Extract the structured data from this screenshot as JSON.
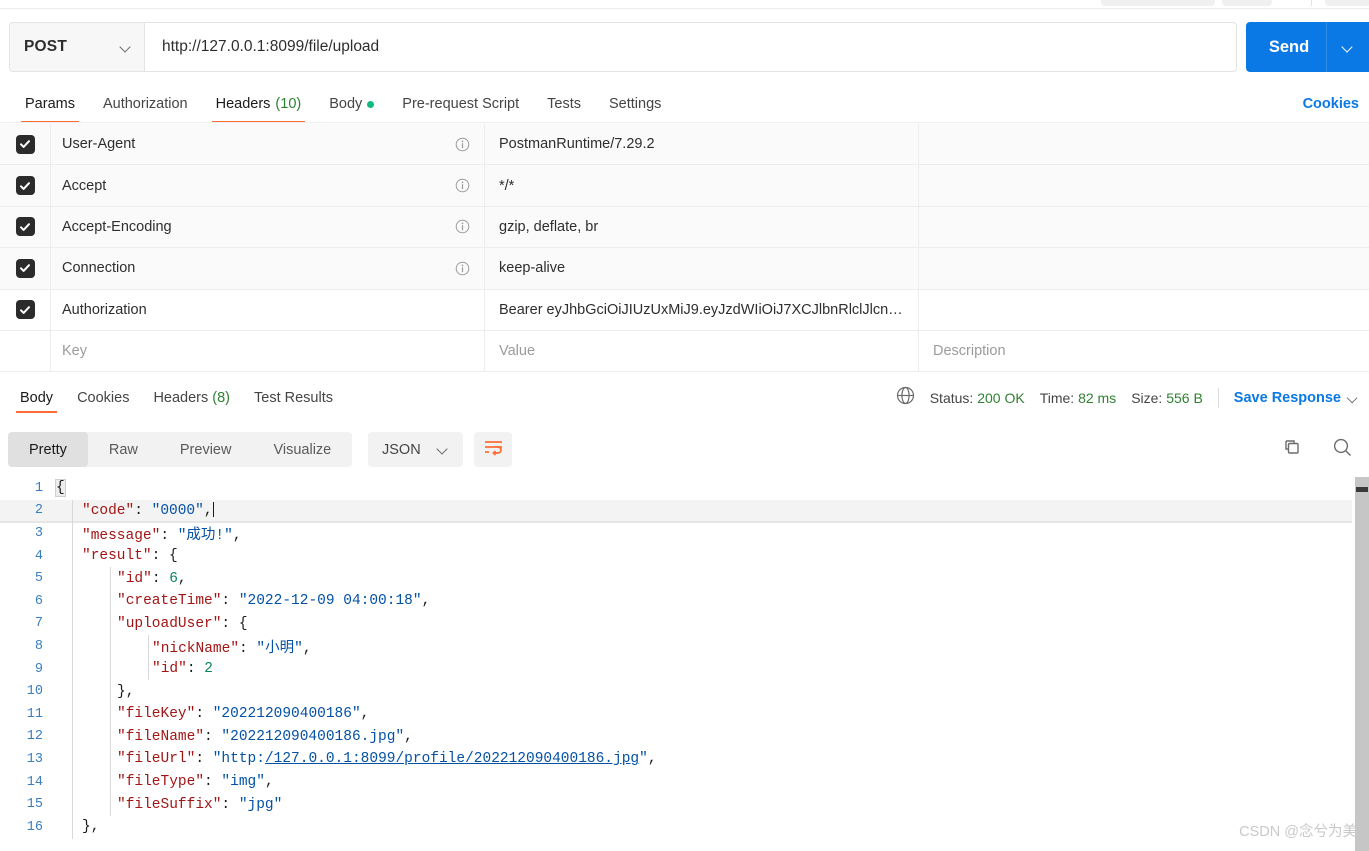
{
  "request": {
    "method": "POST",
    "url": "http://127.0.0.1:8099/file/upload",
    "send_label": "Send",
    "tabs": [
      {
        "label": "Params",
        "count": "",
        "dot": false,
        "active": false
      },
      {
        "label": "Authorization",
        "count": "",
        "dot": false,
        "active": false
      },
      {
        "label": "Headers",
        "count": "(10)",
        "dot": false,
        "active": true
      },
      {
        "label": "Body",
        "count": "",
        "dot": true,
        "active": false
      },
      {
        "label": "Pre-request Script",
        "count": "",
        "dot": false,
        "active": false
      },
      {
        "label": "Tests",
        "count": "",
        "dot": false,
        "active": false
      },
      {
        "label": "Settings",
        "count": "",
        "dot": false,
        "active": false
      }
    ],
    "cookies_link": "Cookies"
  },
  "headers_table": {
    "columns": {
      "key": "Key",
      "value": "Value",
      "description": "Description"
    },
    "rows": [
      {
        "checked": true,
        "key": "User-Agent",
        "value": "PostmanRuntime/7.29.2",
        "info": true,
        "shaded": true
      },
      {
        "checked": true,
        "key": "Accept",
        "value": "*/*",
        "info": true,
        "shaded": true
      },
      {
        "checked": true,
        "key": "Accept-Encoding",
        "value": "gzip, deflate, br",
        "info": true,
        "shaded": true
      },
      {
        "checked": true,
        "key": "Connection",
        "value": "keep-alive",
        "info": true,
        "shaded": true
      },
      {
        "checked": true,
        "key": "Authorization",
        "value": "Bearer  eyJhbGciOiJIUzUxMiJ9.eyJzdWIiOiJ7XCJlbnRlclJlcn…",
        "info": false,
        "shaded": false
      }
    ]
  },
  "response": {
    "tabs": [
      {
        "label": "Body",
        "count": "",
        "active": true
      },
      {
        "label": "Cookies",
        "count": "",
        "active": false
      },
      {
        "label": "Headers",
        "count": "(8)",
        "active": false
      },
      {
        "label": "Test Results",
        "count": "",
        "active": false
      }
    ],
    "status_label": "Status:",
    "status_value": "200 OK",
    "time_label": "Time:",
    "time_value": "82 ms",
    "size_label": "Size:",
    "size_value": "556 B",
    "save_response": "Save Response",
    "view_modes": [
      {
        "label": "Pretty",
        "active": true
      },
      {
        "label": "Raw",
        "active": false
      },
      {
        "label": "Preview",
        "active": false
      },
      {
        "label": "Visualize",
        "active": false
      }
    ],
    "format": "JSON"
  },
  "body_code": {
    "lines": [
      {
        "num": "1",
        "active": false,
        "guides": 0
      },
      {
        "num": "2",
        "active": true,
        "guides": 1
      },
      {
        "num": "3",
        "active": false,
        "guides": 1
      },
      {
        "num": "4",
        "active": false,
        "guides": 1
      },
      {
        "num": "5",
        "active": false,
        "guides": 2
      },
      {
        "num": "6",
        "active": false,
        "guides": 2
      },
      {
        "num": "7",
        "active": false,
        "guides": 2
      },
      {
        "num": "8",
        "active": false,
        "guides": 3
      },
      {
        "num": "9",
        "active": false,
        "guides": 3
      },
      {
        "num": "10",
        "active": false,
        "guides": 2
      },
      {
        "num": "11",
        "active": false,
        "guides": 2
      },
      {
        "num": "12",
        "active": false,
        "guides": 2
      },
      {
        "num": "13",
        "active": false,
        "guides": 2
      },
      {
        "num": "14",
        "active": false,
        "guides": 2
      },
      {
        "num": "15",
        "active": false,
        "guides": 2
      },
      {
        "num": "16",
        "active": false,
        "guides": 1
      }
    ],
    "text": {
      "l1": "{",
      "l2_key": "\"code\"",
      "l2_val": "\"0000\"",
      "l3_key": "\"message\"",
      "l3_val": "\"成功!\"",
      "l4_key": "\"result\"",
      "l5_key": "\"id\"",
      "l5_val": "6",
      "l6_key": "\"createTime\"",
      "l6_val": "\"2022-12-09 04:00:18\"",
      "l7_key": "\"uploadUser\"",
      "l8_key": "\"nickName\"",
      "l8_val": "\"小明\"",
      "l9_key": "\"id\"",
      "l9_val": "2",
      "l10": "},",
      "l11_key": "\"fileKey\"",
      "l11_val": "\"202212090400186\"",
      "l12_key": "\"fileName\"",
      "l12_val": "\"202212090400186.jpg\"",
      "l13_key": "\"fileUrl\"",
      "l13_val_pre": "\"http:",
      "l13_val_link": "/127.0.0.1:8099/profile/202212090400186.jpg",
      "l13_val_post": "\"",
      "l14_key": "\"fileType\"",
      "l14_val": "\"img\"",
      "l15_key": "\"fileSuffix\"",
      "l15_val": "\"jpg\"",
      "l16": "},"
    }
  },
  "watermark": "CSDN @念兮为美",
  "colors": {
    "accent_orange": "#ff6c37",
    "send_blue": "#0b79e5",
    "status_green": "#2f8132",
    "link_blue": "#0451a5",
    "key_red": "#a31515"
  }
}
